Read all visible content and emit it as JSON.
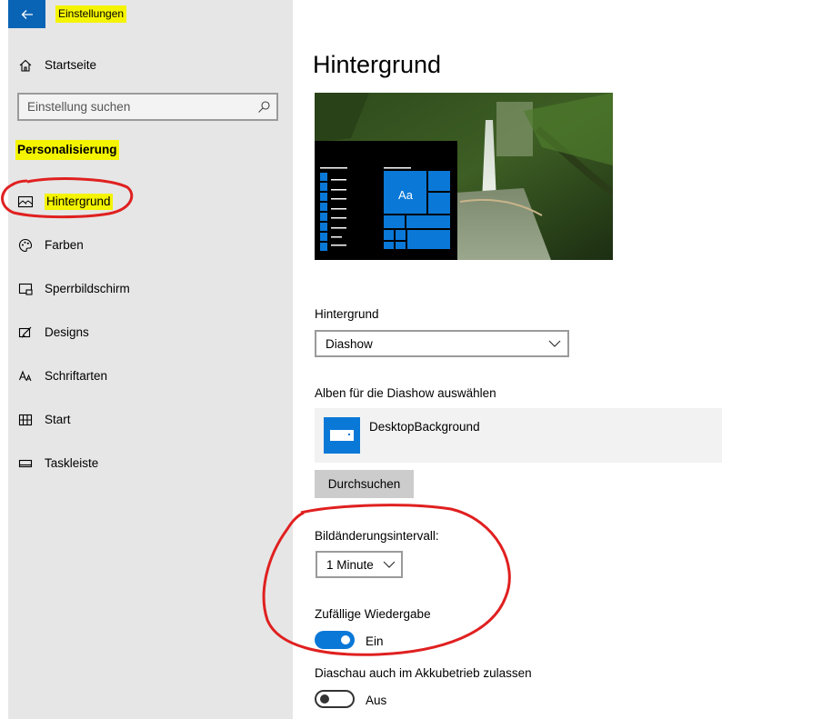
{
  "window": {
    "title": "Einstellungen"
  },
  "sidebar": {
    "home_label": "Startseite",
    "search_placeholder": "Einstellung suchen",
    "section_title": "Personalisierung",
    "items": [
      {
        "label": "Hintergrund",
        "icon": "picture-icon",
        "selected": true
      },
      {
        "label": "Farben",
        "icon": "palette-icon"
      },
      {
        "label": "Sperrbildschirm",
        "icon": "lock-screen-icon"
      },
      {
        "label": "Designs",
        "icon": "designs-icon"
      },
      {
        "label": "Schriftarten",
        "icon": "fonts-icon"
      },
      {
        "label": "Start",
        "icon": "start-icon"
      },
      {
        "label": "Taskleiste",
        "icon": "taskbar-icon"
      }
    ]
  },
  "main": {
    "title": "Hintergrund",
    "preview": {
      "tile_label": "Aa"
    },
    "background_label": "Hintergrund",
    "background_value": "Diashow",
    "albums_label": "Alben für die Diashow auswählen",
    "album_name": "DesktopBackground",
    "browse_label": "Durchsuchen",
    "interval_label": "Bildänderungsintervall:",
    "interval_value": "1 Minute",
    "shuffle_label": "Zufällige Wiedergabe",
    "shuffle_state": "Ein",
    "battery_label": "Diaschau auch im Akkubetrieb zulassen",
    "battery_state": "Aus"
  },
  "colors": {
    "accent": "#0a78d7",
    "sidebar_bg": "#e6e6e6",
    "highlight": "#f4f400",
    "annotation": "#e02020"
  }
}
